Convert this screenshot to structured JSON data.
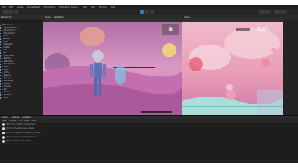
{
  "menu": [
    "File",
    "Edit",
    "Assets",
    "GameObject",
    "Component",
    "Animation Rigging",
    "Tools",
    "Jobs",
    "Window",
    "Help"
  ],
  "hierarchy": {
    "tab": "Hierarchy",
    "rows": [
      "▾ MainScene",
      "  ▸ Directional Light",
      "  ▸ Main Camera",
      "  ▾ Environment",
      "      Terrain",
      "      Balloons",
      "      Clouds",
      "  ▾ Character",
      "      Armature",
      "      Body",
      "      Hair",
      "  ▸ PostProcess",
      "  ▸ Particles",
      "  ▸ UI Canvas",
      "  ▸ EventSystem",
      "  ▸ Audio",
      "  ▸ Props",
      "  ▸ Lights",
      "  ▸ Spawner",
      "  ▸ Manager",
      "  ▸ GameLogic",
      "  ▸ Effects",
      "  ▸ Timeline",
      "  ▸ Rig",
      "  ▸ Volume",
      "  ▸ Cameras",
      "  ▸ Misc"
    ]
  },
  "scene": {
    "tabs": [
      "Scene",
      "Asset Store"
    ]
  },
  "game": {
    "tabs": [
      "Game"
    ],
    "logo_text": "OWN"
  },
  "console": {
    "tabs": [
      "Project",
      "Console",
      "Animation"
    ],
    "tools": [
      "Clear",
      "Collapse",
      "Error Pause",
      "Editor"
    ],
    "logs": [
      "[12:04:31] Initialize engine version",
      "[12:04:32] Loading scene assets",
      "[12:04:33] Shader compilation complete",
      "[12:04:35] Character rig initialized",
      "[12:04:37] Play mode started"
    ]
  },
  "colors": {
    "accent": "#3a79c4",
    "sky": "#e6a3c8",
    "ground": "#c96bb0"
  }
}
